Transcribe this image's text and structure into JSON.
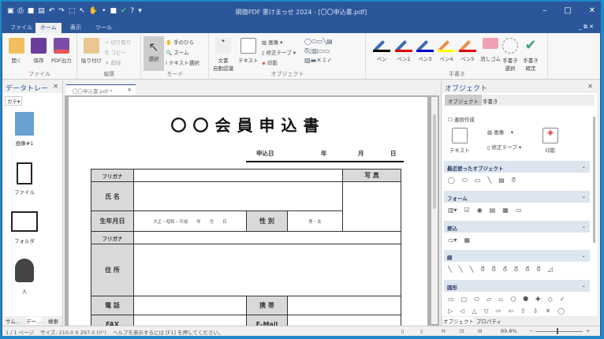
{
  "window": {
    "title": "瞬簡PDF 書けまっせ 2024 - [〇〇申込書.pdf]",
    "controls": [
      "–",
      "□",
      "✕"
    ],
    "mdi": "_ ⧉ ✕"
  },
  "quick_access": [
    "save-icon",
    "print-icon",
    "save-as-icon",
    "undo-icon",
    "redo-icon",
    "select-icon",
    "hand-icon",
    "zoom-icon",
    "stop-icon",
    "check-icon",
    "help-icon"
  ],
  "menu": {
    "tabs": [
      "ファイル",
      "ホーム",
      "表示",
      "ツール"
    ],
    "active": "ホーム"
  },
  "ribbon": {
    "file": {
      "label": "ファイル",
      "buttons": [
        "開く",
        "保存",
        "PDF出力"
      ]
    },
    "edit": {
      "label": "編集",
      "paste": "貼り付け",
      "items": [
        "切り取り",
        "コピー",
        "削除"
      ]
    },
    "mode": {
      "label": "モード",
      "select": "選択",
      "items": [
        "手のひら",
        "ズーム",
        "テキスト選択"
      ]
    },
    "object": {
      "label": "オブジェクト",
      "auto": "文書\n自動認識",
      "text": "テキスト",
      "items": [
        "画像",
        "修正テープ",
        "印影"
      ]
    },
    "handwriting": {
      "label": "手書き",
      "pens": [
        {
          "label": "ペン",
          "color": "#000000"
        },
        {
          "label": "ペン2",
          "color": "#e00000"
        },
        {
          "label": "ペン3",
          "color": "#0000d0"
        },
        {
          "label": "ペン4",
          "color": "#ffff00"
        },
        {
          "label": "ペン5",
          "color": "#e00000"
        }
      ],
      "eraser": "消しゴム",
      "select": "手書き\n選択",
      "confirm": "手書き\n確定"
    }
  },
  "datatray": {
    "title": "データトレー",
    "category": "カテ▾",
    "items": [
      "画像#1",
      "ファイル",
      "フォルダ",
      "人"
    ],
    "tabs": [
      "サム...",
      "デー...",
      "検索"
    ]
  },
  "document": {
    "tab": "〇〇申込書.pdf *",
    "title": "〇〇会員申込書",
    "date": {
      "label": "申込日",
      "year": "年",
      "month": "月",
      "day": "日"
    },
    "form": {
      "furigana": "フリガナ",
      "name": "氏 名",
      "birth": "生年月日",
      "birth_value": "大正・昭和・平成　　年　　月　　日",
      "gender": "性 別",
      "gender_value": "男・女",
      "photo": "写 真",
      "furigana2": "フリガナ",
      "address": "住 所",
      "phone": "電 話",
      "mobile": "携 帯",
      "fax": "FAX",
      "email": "E-Mail"
    }
  },
  "objectpanel": {
    "title": "オブジェクト",
    "tabs": [
      "オブジェクト",
      "手書き"
    ],
    "continuous": "連続作成",
    "text": "テキスト",
    "image": "画像",
    "tape": "修正テープ",
    "stamp": "印影",
    "sections": [
      "最近使ったオブジェクト",
      "フォーム",
      "差込",
      "線",
      "図形"
    ],
    "bottom_tabs": [
      "オブジェクト",
      "プロパティ"
    ]
  },
  "status": {
    "page": "1 / 1 ページ",
    "size": "サイズ: 210.0 X 297.0 (0°)",
    "help": "ヘルプを表示するには [F1] を押してください。",
    "zoom": "89.8%",
    "zoom_level": 89.8
  },
  "colors": {
    "accent": "#2b579a"
  }
}
